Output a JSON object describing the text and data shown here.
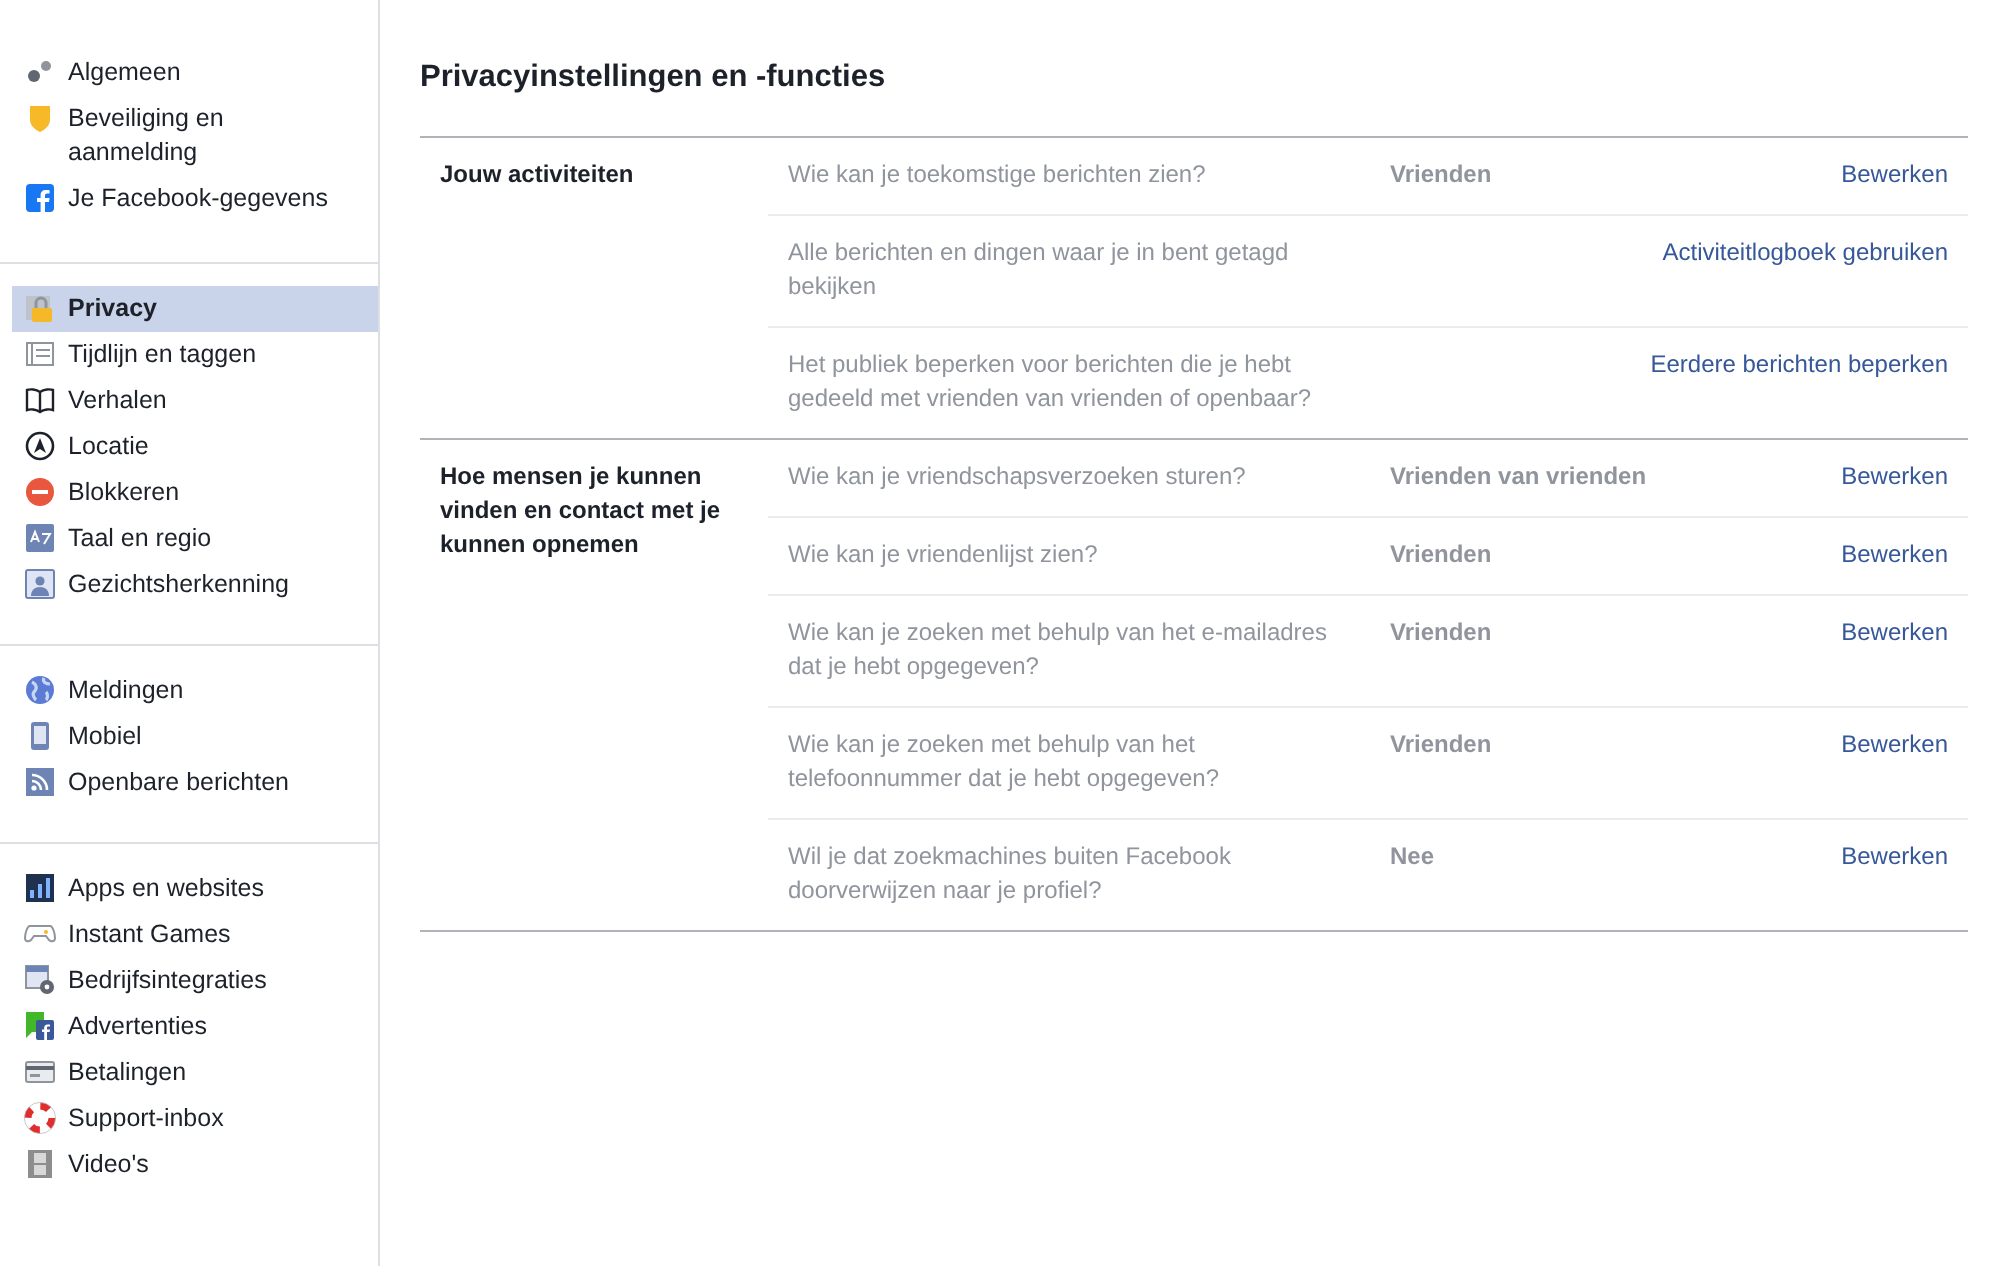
{
  "sidebar": {
    "groups": [
      {
        "items": [
          {
            "label": "Algemeen",
            "selected": false
          },
          {
            "label": "Beveiliging en aanmelding",
            "selected": false
          },
          {
            "label": "Je Facebook-gegevens",
            "selected": false
          }
        ]
      },
      {
        "items": [
          {
            "label": "Privacy",
            "selected": true
          },
          {
            "label": "Tijdlijn en taggen",
            "selected": false
          },
          {
            "label": "Verhalen",
            "selected": false
          },
          {
            "label": "Locatie",
            "selected": false
          },
          {
            "label": "Blokkeren",
            "selected": false
          },
          {
            "label": "Taal en regio",
            "selected": false
          },
          {
            "label": "Gezichtsherkenning",
            "selected": false
          }
        ]
      },
      {
        "items": [
          {
            "label": "Meldingen",
            "selected": false
          },
          {
            "label": "Mobiel",
            "selected": false
          },
          {
            "label": "Openbare berichten",
            "selected": false
          }
        ]
      },
      {
        "items": [
          {
            "label": "Apps en websites",
            "selected": false
          },
          {
            "label": "Instant Games",
            "selected": false
          },
          {
            "label": "Bedrijfsintegraties",
            "selected": false
          },
          {
            "label": "Advertenties",
            "selected": false
          },
          {
            "label": "Betalingen",
            "selected": false
          },
          {
            "label": "Support-inbox",
            "selected": false
          },
          {
            "label": "Video's",
            "selected": false
          }
        ]
      }
    ]
  },
  "title": "Privacyinstellingen en -functies",
  "sections": [
    {
      "heading": "Jouw activiteiten",
      "rows": [
        {
          "question": "Wie kan je toekomstige berichten zien?",
          "value": "Vrienden",
          "action": "Bewerken"
        },
        {
          "question": "Alle berichten en dingen waar je in bent getagd bekijken",
          "action": "Activiteitlogboek gebruiken"
        },
        {
          "question": "Het publiek beperken voor berichten die je hebt gedeeld met vrienden van vrienden of openbaar?",
          "action": "Eerdere berichten beperken"
        }
      ]
    },
    {
      "heading": "Hoe mensen je kunnen vinden en contact met je kunnen opnemen",
      "rows": [
        {
          "question": "Wie kan je vriendschapsverzoeken sturen?",
          "value": "Vrienden van vrienden",
          "action": "Bewerken"
        },
        {
          "question": "Wie kan je vriendenlijst zien?",
          "value": "Vrienden",
          "action": "Bewerken"
        },
        {
          "question": "Wie kan je zoeken met behulp van het e-mailadres dat je hebt opgegeven?",
          "value": "Vrienden",
          "action": "Bewerken"
        },
        {
          "question": "Wie kan je zoeken met behulp van het telefoonnummer dat je hebt opgegeven?",
          "value": "Vrienden",
          "action": "Bewerken"
        },
        {
          "question": "Wil je dat zoekmachines buiten Facebook doorverwijzen naar je profiel?",
          "value": "Nee",
          "action": "Bewerken"
        }
      ]
    }
  ]
}
